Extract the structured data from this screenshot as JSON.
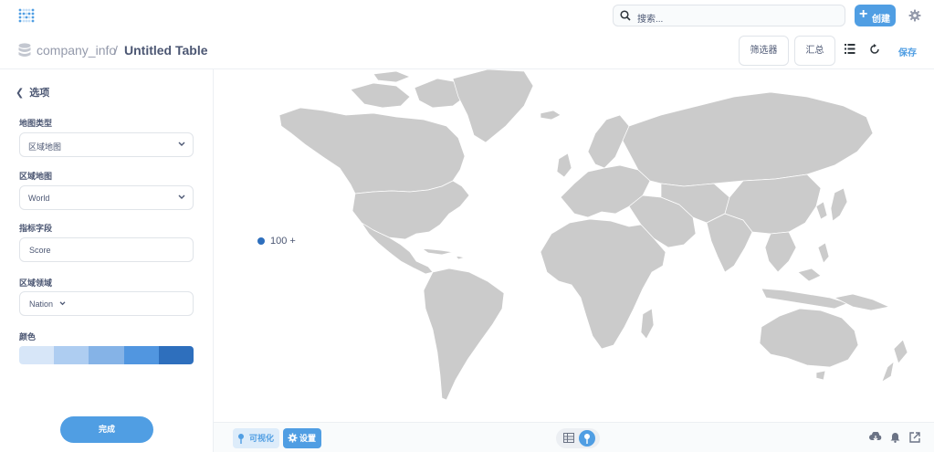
{
  "topbar": {
    "search_placeholder": "搜索...",
    "create_label": "创建"
  },
  "header": {
    "database": "company_info",
    "separator": "/",
    "title": "Untitled Table",
    "filter_label": "筛选器",
    "summarize_label": "汇总",
    "save_label": "保存"
  },
  "sidebar": {
    "back_label": "选项",
    "map_type": {
      "label": "地图类型",
      "value": "区域地图"
    },
    "region_map": {
      "label": "区域地图",
      "value": "World"
    },
    "metric_field": {
      "label": "指标字段",
      "value": "Score"
    },
    "region_field": {
      "label": "区域领域",
      "value": "Nation"
    },
    "color": {
      "label": "颜色",
      "swatches": [
        "#d7e6f8",
        "#aecdf1",
        "#85b3e7",
        "#5196e0",
        "#2e6fbd"
      ]
    },
    "done_label": "完成"
  },
  "main": {
    "legend_label": "100 +",
    "land_color": "#cbcbcb"
  },
  "footer": {
    "visualize_label": "可视化",
    "settings_label": "设置"
  },
  "colors": {
    "accent": "#509ee3",
    "text": "#4c5773",
    "muted": "#949aab"
  }
}
